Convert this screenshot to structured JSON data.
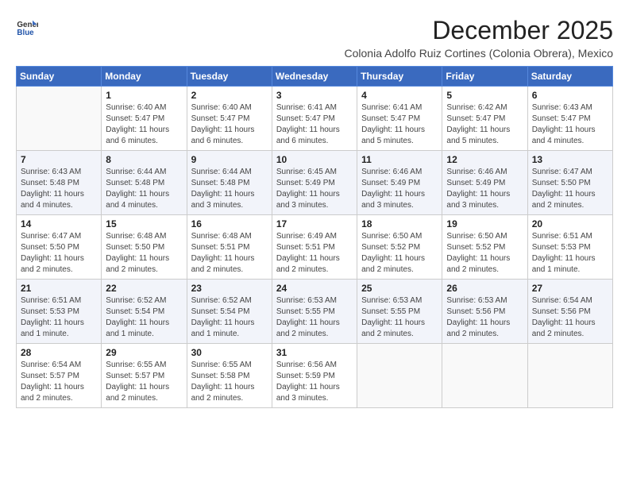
{
  "header": {
    "logo_general": "General",
    "logo_blue": "Blue",
    "month_title": "December 2025",
    "subtitle": "Colonia Adolfo Ruiz Cortines (Colonia Obrera), Mexico"
  },
  "weekdays": [
    "Sunday",
    "Monday",
    "Tuesday",
    "Wednesday",
    "Thursday",
    "Friday",
    "Saturday"
  ],
  "weeks": [
    [
      {
        "day": "",
        "sunrise": "",
        "sunset": "",
        "daylight": ""
      },
      {
        "day": "1",
        "sunrise": "6:40 AM",
        "sunset": "5:47 PM",
        "daylight": "11 hours and 6 minutes."
      },
      {
        "day": "2",
        "sunrise": "6:40 AM",
        "sunset": "5:47 PM",
        "daylight": "11 hours and 6 minutes."
      },
      {
        "day": "3",
        "sunrise": "6:41 AM",
        "sunset": "5:47 PM",
        "daylight": "11 hours and 6 minutes."
      },
      {
        "day": "4",
        "sunrise": "6:41 AM",
        "sunset": "5:47 PM",
        "daylight": "11 hours and 5 minutes."
      },
      {
        "day": "5",
        "sunrise": "6:42 AM",
        "sunset": "5:47 PM",
        "daylight": "11 hours and 5 minutes."
      },
      {
        "day": "6",
        "sunrise": "6:43 AM",
        "sunset": "5:47 PM",
        "daylight": "11 hours and 4 minutes."
      }
    ],
    [
      {
        "day": "7",
        "sunrise": "6:43 AM",
        "sunset": "5:48 PM",
        "daylight": "11 hours and 4 minutes."
      },
      {
        "day": "8",
        "sunrise": "6:44 AM",
        "sunset": "5:48 PM",
        "daylight": "11 hours and 4 minutes."
      },
      {
        "day": "9",
        "sunrise": "6:44 AM",
        "sunset": "5:48 PM",
        "daylight": "11 hours and 3 minutes."
      },
      {
        "day": "10",
        "sunrise": "6:45 AM",
        "sunset": "5:49 PM",
        "daylight": "11 hours and 3 minutes."
      },
      {
        "day": "11",
        "sunrise": "6:46 AM",
        "sunset": "5:49 PM",
        "daylight": "11 hours and 3 minutes."
      },
      {
        "day": "12",
        "sunrise": "6:46 AM",
        "sunset": "5:49 PM",
        "daylight": "11 hours and 3 minutes."
      },
      {
        "day": "13",
        "sunrise": "6:47 AM",
        "sunset": "5:50 PM",
        "daylight": "11 hours and 2 minutes."
      }
    ],
    [
      {
        "day": "14",
        "sunrise": "6:47 AM",
        "sunset": "5:50 PM",
        "daylight": "11 hours and 2 minutes."
      },
      {
        "day": "15",
        "sunrise": "6:48 AM",
        "sunset": "5:50 PM",
        "daylight": "11 hours and 2 minutes."
      },
      {
        "day": "16",
        "sunrise": "6:48 AM",
        "sunset": "5:51 PM",
        "daylight": "11 hours and 2 minutes."
      },
      {
        "day": "17",
        "sunrise": "6:49 AM",
        "sunset": "5:51 PM",
        "daylight": "11 hours and 2 minutes."
      },
      {
        "day": "18",
        "sunrise": "6:50 AM",
        "sunset": "5:52 PM",
        "daylight": "11 hours and 2 minutes."
      },
      {
        "day": "19",
        "sunrise": "6:50 AM",
        "sunset": "5:52 PM",
        "daylight": "11 hours and 2 minutes."
      },
      {
        "day": "20",
        "sunrise": "6:51 AM",
        "sunset": "5:53 PM",
        "daylight": "11 hours and 1 minute."
      }
    ],
    [
      {
        "day": "21",
        "sunrise": "6:51 AM",
        "sunset": "5:53 PM",
        "daylight": "11 hours and 1 minute."
      },
      {
        "day": "22",
        "sunrise": "6:52 AM",
        "sunset": "5:54 PM",
        "daylight": "11 hours and 1 minute."
      },
      {
        "day": "23",
        "sunrise": "6:52 AM",
        "sunset": "5:54 PM",
        "daylight": "11 hours and 1 minute."
      },
      {
        "day": "24",
        "sunrise": "6:53 AM",
        "sunset": "5:55 PM",
        "daylight": "11 hours and 2 minutes."
      },
      {
        "day": "25",
        "sunrise": "6:53 AM",
        "sunset": "5:55 PM",
        "daylight": "11 hours and 2 minutes."
      },
      {
        "day": "26",
        "sunrise": "6:53 AM",
        "sunset": "5:56 PM",
        "daylight": "11 hours and 2 minutes."
      },
      {
        "day": "27",
        "sunrise": "6:54 AM",
        "sunset": "5:56 PM",
        "daylight": "11 hours and 2 minutes."
      }
    ],
    [
      {
        "day": "28",
        "sunrise": "6:54 AM",
        "sunset": "5:57 PM",
        "daylight": "11 hours and 2 minutes."
      },
      {
        "day": "29",
        "sunrise": "6:55 AM",
        "sunset": "5:57 PM",
        "daylight": "11 hours and 2 minutes."
      },
      {
        "day": "30",
        "sunrise": "6:55 AM",
        "sunset": "5:58 PM",
        "daylight": "11 hours and 2 minutes."
      },
      {
        "day": "31",
        "sunrise": "6:56 AM",
        "sunset": "5:59 PM",
        "daylight": "11 hours and 3 minutes."
      },
      {
        "day": "",
        "sunrise": "",
        "sunset": "",
        "daylight": ""
      },
      {
        "day": "",
        "sunrise": "",
        "sunset": "",
        "daylight": ""
      },
      {
        "day": "",
        "sunrise": "",
        "sunset": "",
        "daylight": ""
      }
    ]
  ],
  "labels": {
    "sunrise_prefix": "Sunrise: ",
    "sunset_prefix": "Sunset: ",
    "daylight_prefix": "Daylight: "
  }
}
